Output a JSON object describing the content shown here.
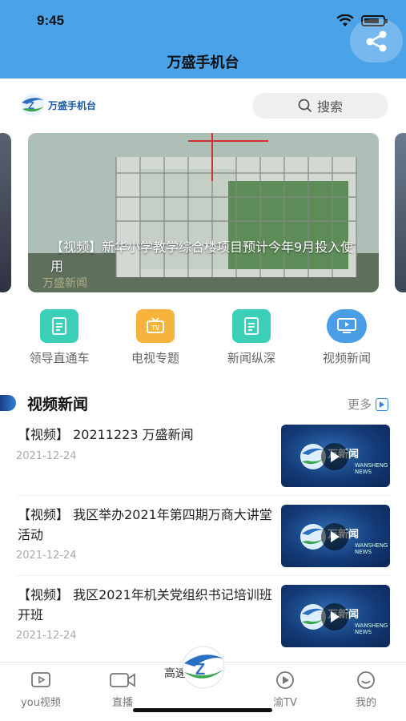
{
  "status": {
    "time": "9:45",
    "signal_dots": "····"
  },
  "header": {
    "title": "万盛手机台"
  },
  "brand": {
    "logo_text": "万盛手机台"
  },
  "search": {
    "label": "搜索"
  },
  "banner": {
    "caption": "【视频】新华小学教学综合楼项目预计今年9月投入使用",
    "watermark": "万盛新闻"
  },
  "quicknav": [
    {
      "label": "领导直通车",
      "icon": "document-icon",
      "color": "#3ccfb8"
    },
    {
      "label": "电视专题",
      "icon": "tv-icon",
      "color": "#f7b43c"
    },
    {
      "label": "新闻纵深",
      "icon": "document-icon",
      "color": "#3ccfb8"
    },
    {
      "label": "视频新闻",
      "icon": "monitor-icon",
      "color": "#4a9ee6"
    }
  ],
  "section": {
    "title": "视频新闻",
    "more": "更多"
  },
  "news": [
    {
      "title": "【视频】 20211223 万盛新闻",
      "date": "2021-12-24",
      "thumb_text": "万新闻",
      "thumb_sub": "WANSHENG NEWS"
    },
    {
      "title": "【视频】 我区举办2021年第四期万商大讲堂活动",
      "date": "2021-12-24",
      "thumb_text": "万新闻",
      "thumb_sub": "WANSHENG NEWS"
    },
    {
      "title": "【视频】 我区2021年机关党组织书记培训班开班",
      "date": "2021-12-24",
      "thumb_text": "万新闻",
      "thumb_sub": "WANSHENG NEWS"
    }
  ],
  "tabbar": {
    "tabs": [
      {
        "label": "you视频",
        "icon": "play-square-icon"
      },
      {
        "label": "直播",
        "icon": "camera-icon"
      },
      {
        "label": "渝TV",
        "icon": "play-circle-icon"
      },
      {
        "label": "我的",
        "icon": "smile-icon"
      }
    ],
    "center_marquee": "高速公路"
  },
  "colors": {
    "header_bg": "#4aa2e8",
    "accent": "#2e86de"
  }
}
